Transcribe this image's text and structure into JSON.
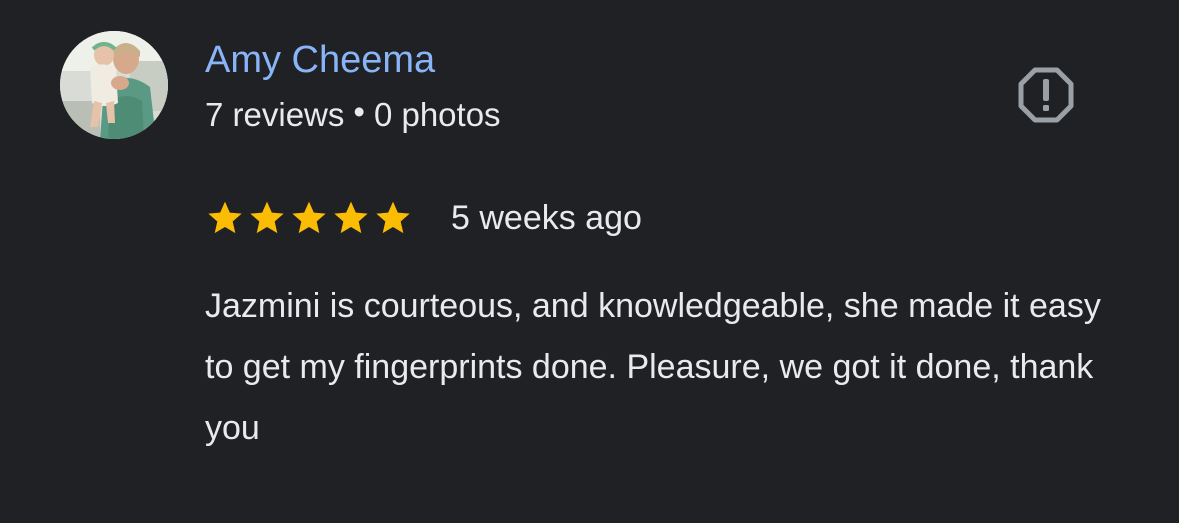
{
  "review": {
    "reviewer": {
      "name": "Amy Cheema",
      "reviews_count": "7 reviews",
      "separator": "•",
      "photos_count": "0 photos",
      "avatar_icon": "profile-photo"
    },
    "report_icon": "report-octagon-icon",
    "rating": {
      "stars": 5,
      "max_stars": 5,
      "star_color": "#fbbc04"
    },
    "date": "5 weeks ago",
    "text": "Jazmini is courteous, and knowledgeable, she made it easy to get my fingerprints done. Pleasure, we got it done, thank you"
  },
  "colors": {
    "background": "#202124",
    "name_link": "#8ab4f8",
    "text": "#e8eaed",
    "icon_gray": "#9aa0a6"
  }
}
